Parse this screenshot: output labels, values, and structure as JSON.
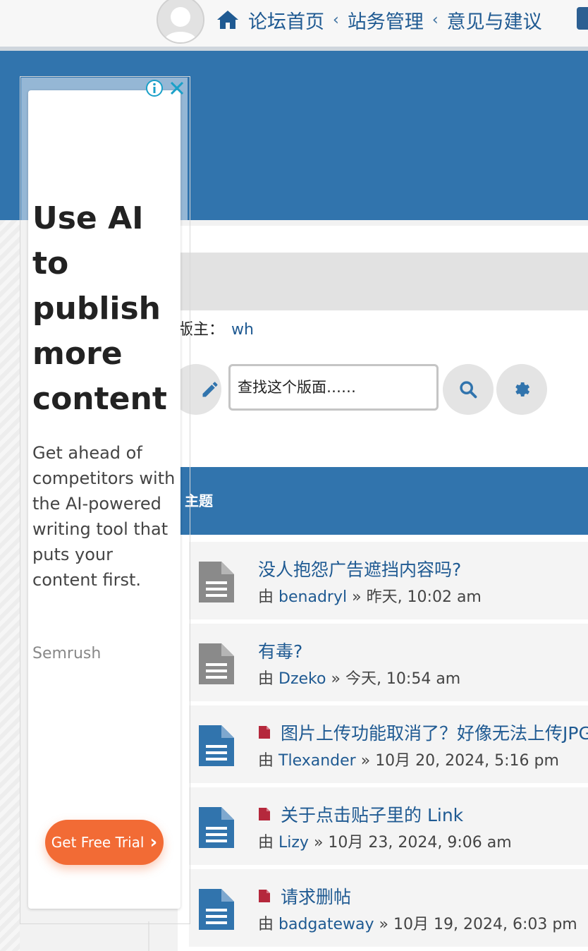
{
  "breadcrumb": {
    "items": [
      "论坛首页",
      "站务管理",
      "意见与建议"
    ],
    "separator": "‹"
  },
  "forum": {
    "moderator_label": "版主：",
    "moderator_name": "wh",
    "search_placeholder": "查找这个版面……",
    "topics_header": "主题"
  },
  "topics": [
    {
      "title": "没人抱怨广告遮挡内容吗?",
      "by": "由",
      "author": "benadryl",
      "sep": "»",
      "time": "昨天, 10:02 am",
      "icon": "file-gray-icon",
      "hot": false
    },
    {
      "title": "有毒?",
      "by": "由",
      "author": "Dzeko",
      "sep": "»",
      "time": "今天, 10:54 am",
      "icon": "file-gray-icon",
      "hot": false
    },
    {
      "title": "图片上传功能取消了？好像无法上传JPG",
      "by": "由",
      "author": "Tlexander",
      "sep": "»",
      "time": "10月 20, 2024, 5:16 pm",
      "icon": "file-blue-icon",
      "hot": true
    },
    {
      "title": "关于点击贴子里的 Link",
      "by": "由",
      "author": "Lizy",
      "sep": "»",
      "time": "10月 23, 2024, 9:06 am",
      "icon": "file-blue-icon",
      "hot": true
    },
    {
      "title": "请求删帖",
      "by": "由",
      "author": "badgateway",
      "sep": "»",
      "time": "10月 19, 2024, 6:03 pm",
      "icon": "file-blue-icon",
      "hot": true
    }
  ],
  "ad": {
    "headline": "Use AI to publish more content",
    "body": "Get ahead of competitors with the AI-powered writing tool that puts your content first.",
    "brand": "Semrush",
    "cta": "Get Free Trial",
    "cta_chevron": "›"
  },
  "colors": {
    "primary": "#3174ad",
    "link": "#1f5a92",
    "cta": "#f26b35",
    "hot": "#b5283c"
  }
}
